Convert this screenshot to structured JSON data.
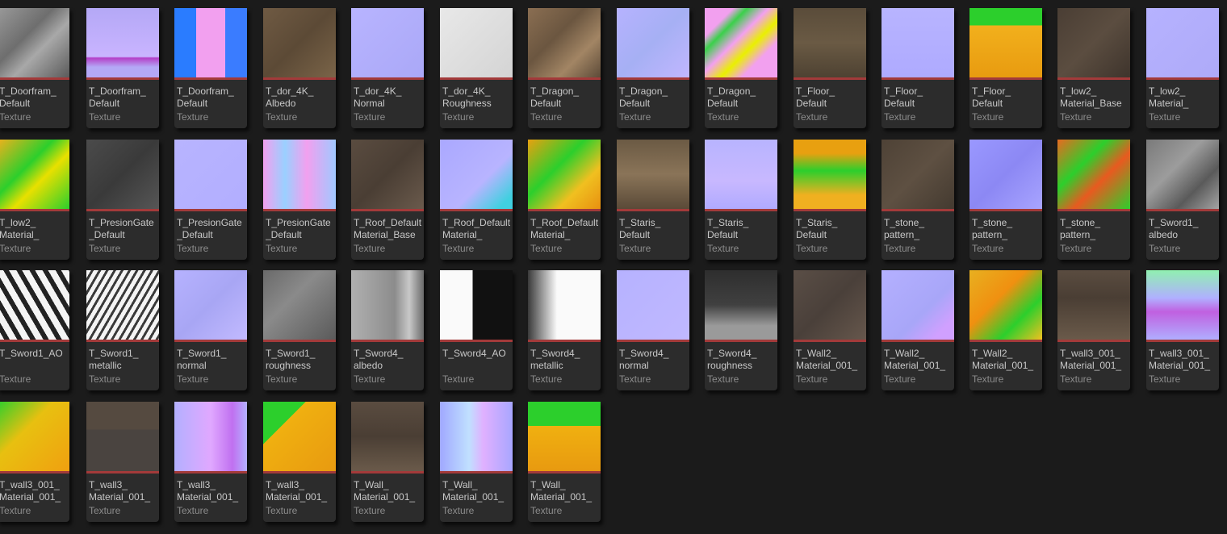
{
  "asset_type_label": "Texture",
  "colors": {
    "background": "#1b1b1b",
    "tile": "#2c2c2c",
    "type_underline": "#a33a3a"
  },
  "assets": [
    {
      "name": "T_Doorfram_\nDefault",
      "thumb": "linear-gradient(135deg,#9a9a9a,#6e6e6e 40%,#a8a8a8 60%,#5a5a5a)"
    },
    {
      "name": "T_Doorfram_\nDefault",
      "thumb": "linear-gradient(180deg,#b4a8f6,#c9b4ff 70%,#b43fc8 72%,#b4a8f6 85%)"
    },
    {
      "name": "T_Doorfram_\nDefault",
      "thumb": "linear-gradient(90deg,#2a7cff 30%,#f2a0ef 30%,#f2a0ef 70%,#3a7cff 70%)"
    },
    {
      "name": "T_dor_4K_\nAlbedo",
      "thumb": "linear-gradient(135deg,#6f5a43,#5c4a36 50%,#7a6448)"
    },
    {
      "name": "T_dor_4K_\nNormal",
      "thumb": "linear-gradient(135deg,#b8b4ff,#aaa8f7)"
    },
    {
      "name": "T_dor_4K_\nRoughness",
      "thumb": "linear-gradient(135deg,#e8e8e8,#d4d4d4)"
    },
    {
      "name": "T_Dragon_\nDefault",
      "thumb": "linear-gradient(135deg,#8a6e52,#6b5640 40%,#a28564 70%,#5c4a38)"
    },
    {
      "name": "T_Dragon_\nDefault",
      "thumb": "linear-gradient(135deg,#b6b2ff,#a6b0f4 50%,#c1b6ff)"
    },
    {
      "name": "T_Dragon_\nDefault",
      "thumb": "linear-gradient(135deg,#f2a0ef 20%,#3ad04a 30%,#f2a0ef 45%,#eaf000 60%,#f2a0ef 75%)"
    },
    {
      "name": "T_Floor_\nDefault",
      "thumb": "linear-gradient(180deg,#5a4c3a,#6a5a44 50%,#4e4232)"
    },
    {
      "name": "T_Floor_\nDefault",
      "thumb": "linear-gradient(180deg,#b8b4ff,#aeaaff)"
    },
    {
      "name": "T_Floor_\nDefault",
      "thumb": "linear-gradient(180deg,#2ccf2c 25%,#f2b01c 25%,#e89b10)"
    },
    {
      "name": "T_low2_\nMaterial_Base",
      "thumb": "linear-gradient(135deg,#4a3e34,#5b4d40 50%,#3e342c)"
    },
    {
      "name": "T_low2_\nMaterial_",
      "thumb": "linear-gradient(135deg,#b6b2ff,#aeaaf8)"
    },
    {
      "name": "T_low2_\nMaterial_",
      "thumb": "linear-gradient(135deg,#f2b01c,#2ccf2c 40%,#e8e000 60%,#2ccf2c)"
    },
    {
      "name": "T_PresionGate\n_Default",
      "thumb": "linear-gradient(135deg,#4b4b4b,#3a3a3a 50%,#565656)"
    },
    {
      "name": "T_PresionGate\n_Default",
      "thumb": "linear-gradient(135deg,#b8b4ff,#b2aeff)"
    },
    {
      "name": "T_PresionGate\n_Default",
      "thumb": "linear-gradient(90deg,#f2a0ef,#9ad0ff 30%,#f2a0ef 60%,#a0c8ff)"
    },
    {
      "name": "T_Roof_Default\nMaterial_Base",
      "thumb": "linear-gradient(135deg,#5a4c40,#4a3e34 50%,#6a5a4c)"
    },
    {
      "name": "T_Roof_Default\nMaterial_",
      "thumb": "linear-gradient(135deg,#aaa8ff,#b8b4ff 60%,#40d0e0 90%)"
    },
    {
      "name": "T_Roof_Default\nMaterial_",
      "thumb": "linear-gradient(135deg,#e8a010,#2ccf2c 40%,#f0c020 70%,#e89010)"
    },
    {
      "name": "T_Staris_\nDefault",
      "thumb": "linear-gradient(180deg,#6b5a44,#8a7458 50%,#5a4a38)"
    },
    {
      "name": "T_Staris_\nDefault",
      "thumb": "linear-gradient(180deg,#b8b4ff,#c8b8ff 60%,#b0aaff)"
    },
    {
      "name": "T_Staris_\nDefault",
      "thumb": "linear-gradient(180deg,#e8a010 20%,#2ccf2c 45%,#f0b020 80%)"
    },
    {
      "name": "T_stone_\npattern_",
      "thumb": "linear-gradient(135deg,#4e4236,#5e5042 50%,#443a30)"
    },
    {
      "name": "T_stone_\npattern_",
      "thumb": "linear-gradient(135deg,#9a98ff,#8c88f4 50%,#a8a4ff)"
    },
    {
      "name": "T_stone_\npattern_",
      "thumb": "linear-gradient(135deg,#e86a20,#2ccf2c 35%,#e85a20 60%,#2ccf2c)"
    },
    {
      "name": "T_Sword1_\nalbedo",
      "thumb": "linear-gradient(135deg,#7a7a7a,#9c9c9c 40%,#5a5a5a 70%,#a4a4a4)"
    },
    {
      "name": "T_Sword1_AO\n",
      "thumb": "repeating-linear-gradient(60deg,#f4f4f4 0 8px,#222 8px 14px)"
    },
    {
      "name": "T_Sword1_\nmetallic",
      "thumb": "repeating-linear-gradient(120deg,#f4f4f4 0 5px,#3a3a3a 5px 8px)"
    },
    {
      "name": "T_Sword1_\nnormal",
      "thumb": "linear-gradient(135deg,#b6b2ff,#a8a6f4 50%,#c2baff)"
    },
    {
      "name": "T_Sword1_\nroughness",
      "thumb": "linear-gradient(135deg,#6a6a6a,#8a8a8a 40%,#5a5a5a)"
    },
    {
      "name": "T_Sword4_\nalbedo",
      "thumb": "linear-gradient(90deg,#b0b0b0,#8c8c8c 60%,#c8c8c8 80%,#6a6a6a)"
    },
    {
      "name": "T_Sword4_AO\n",
      "thumb": "linear-gradient(90deg,#fafafa 45%,#111 45%)"
    },
    {
      "name": "T_Sword4_\nmetallic",
      "thumb": "linear-gradient(90deg,#3a3a3a,#fafafa 40%,#fafafa)"
    },
    {
      "name": "T_Sword4_\nnormal",
      "thumb": "linear-gradient(135deg,#b6b2ff,#c0b8ff)"
    },
    {
      "name": "T_Sword4_\nroughness",
      "thumb": "linear-gradient(180deg,#2e2e2e,#404040 50%,#9a9a9a 80%)"
    },
    {
      "name": "T_Wall2_\nMaterial_001_",
      "thumb": "linear-gradient(135deg,#5a4e46,#4a403a 50%,#66574c)"
    },
    {
      "name": "T_Wall2_\nMaterial_001_",
      "thumb": "linear-gradient(135deg,#b4b0ff,#a8a6f8 60%,#d0a0ff 85%)"
    },
    {
      "name": "T_Wall2_\nMaterial_001_",
      "thumb": "linear-gradient(135deg,#e8b020,#f09010 40%,#2ccf2c 70%,#f0c020)"
    },
    {
      "name": "T_wall3_001_\nMaterial_001_",
      "thumb": "linear-gradient(180deg,#5a4c40,#4a3e34 40%,#6a5a4a)"
    },
    {
      "name": "T_wall3_001_\nMaterial_001_",
      "thumb": "linear-gradient(180deg,#90f0b0,#b0b0ff 40%,#c060e0 60%,#b0aeff)"
    },
    {
      "name": "T_wall3_001_\nMaterial_001_",
      "thumb": "linear-gradient(135deg,#2ccf2c,#e8c010 40%,#f0a010)"
    },
    {
      "name": "T_wall3_\nMaterial_001_",
      "thumb": "linear-gradient(180deg,#554a40 40%,#4a4440 40%)"
    },
    {
      "name": "T_wall3_\nMaterial_001_",
      "thumb": "linear-gradient(90deg,#b4b0ff,#e0a8ff 50%,#c070f0 80%,#b4b0ff)"
    },
    {
      "name": "T_wall3_\nMaterial_001_",
      "thumb": "linear-gradient(135deg,#2ccf2c 30%,#f0b010 30%,#e89a10)"
    },
    {
      "name": "T_Wall_\nMaterial_001_",
      "thumb": "linear-gradient(180deg,#5a4c40,#4a3e34 50%,#6a5a4a)"
    },
    {
      "name": "T_Wall_\nMaterial_001_",
      "thumb": "linear-gradient(90deg,#a0a8ff,#c0e0ff 40%,#e0b0ff 60%,#a8a6ff)"
    },
    {
      "name": "T_Wall_\nMaterial_001_",
      "thumb": "linear-gradient(180deg,#2ccf2c 35%,#f0b010 35%,#e89a10)"
    }
  ]
}
